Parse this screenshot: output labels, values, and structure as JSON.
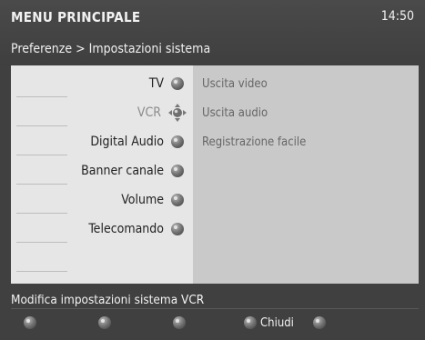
{
  "header": {
    "title": "MENU PRINCIPALE",
    "time": "14:50",
    "breadcrumb": "Preferenze > Impostazioni sistema"
  },
  "menu": {
    "items": [
      {
        "label": "TV",
        "icon": "knob-icon",
        "state": "normal"
      },
      {
        "label": "VCR",
        "icon": "dpad-icon",
        "state": "selected-disabled"
      },
      {
        "label": "Digital Audio",
        "icon": "knob-icon",
        "state": "normal"
      },
      {
        "label": "Banner canale",
        "icon": "knob-icon",
        "state": "normal"
      },
      {
        "label": "Volume",
        "icon": "knob-icon",
        "state": "normal"
      },
      {
        "label": "Telecomando",
        "icon": "knob-icon",
        "state": "normal"
      }
    ],
    "subitems": [
      {
        "label": "Uscita video"
      },
      {
        "label": "Uscita audio"
      },
      {
        "label": "Registrazione facile"
      }
    ]
  },
  "status": {
    "text": "Modifica impostazioni sistema VCR"
  },
  "footer": {
    "buttons": [
      {
        "label": "",
        "icon": "red-knob-icon"
      },
      {
        "label": "",
        "icon": "green-knob-icon"
      },
      {
        "label": "",
        "icon": "yellow-knob-icon"
      },
      {
        "label": "Chiudi",
        "icon": "blue-knob-icon"
      },
      {
        "label": "",
        "icon": "white-knob-icon"
      }
    ]
  }
}
